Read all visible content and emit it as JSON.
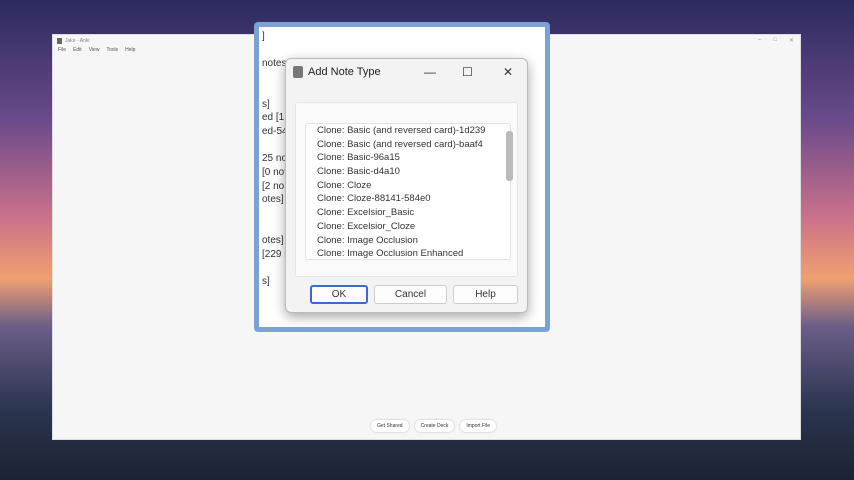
{
  "main_window": {
    "title": "Jake - Anki",
    "menu": [
      "File",
      "Edit",
      "View",
      "Tools",
      "Help"
    ],
    "controls": [
      "–",
      "□",
      "✕"
    ],
    "bottom_buttons": [
      "Get Shared",
      "Create Deck",
      "Import File"
    ]
  },
  "background_window": {
    "fragments": [
      "]",
      "notes",
      "s]",
      "ed [1",
      "ed-54",
      "25 not",
      "[0 not",
      "[2 no",
      "otes]",
      "otes]",
      "[229 r",
      "s]"
    ]
  },
  "dialog": {
    "title": "Add Note Type",
    "controls": {
      "minimize": "—",
      "maximize": "☐",
      "close": "✕"
    },
    "items": [
      "Clone: Basic (and reversed card)-1d239",
      "Clone: Basic (and reversed card)-baaf4",
      "Clone: Basic-96a15",
      "Clone: Basic-d4a10",
      "Clone: Cloze",
      "Clone: Cloze-88141-584e0",
      "Clone: Excelsior_Basic",
      "Clone: Excelsior_Cloze",
      "Clone: Image Occlusion",
      "Clone: Image Occlusion Enhanced"
    ],
    "ok": "OK",
    "cancel": "Cancel",
    "help": "Help"
  }
}
